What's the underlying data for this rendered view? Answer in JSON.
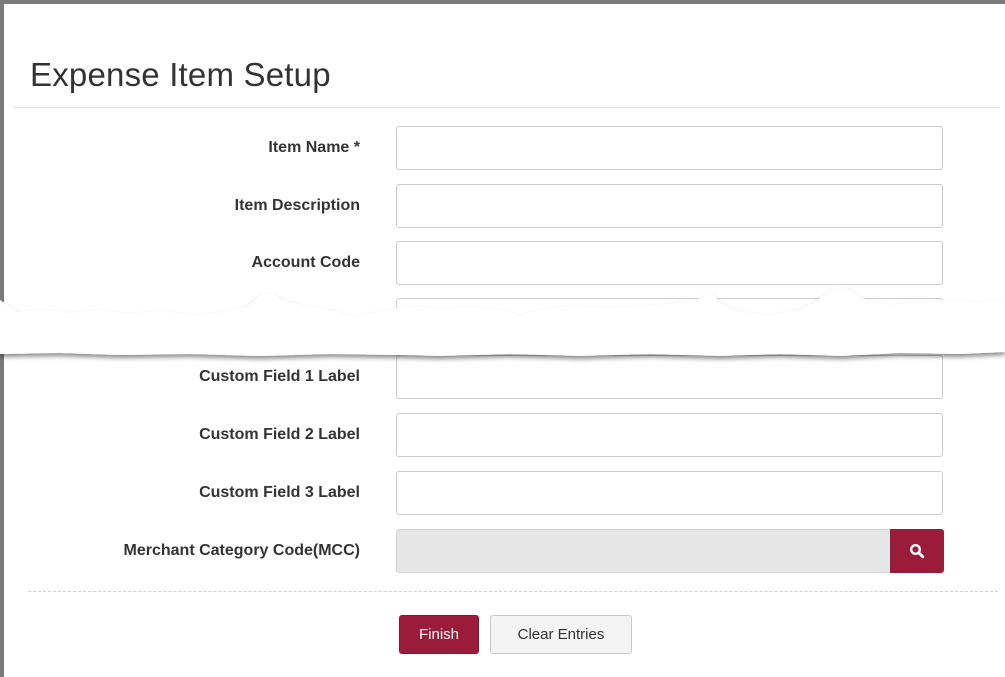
{
  "page": {
    "title": "Expense Item Setup"
  },
  "form": {
    "fields": [
      {
        "label": "Item Name *",
        "value": "",
        "placeholder": ""
      },
      {
        "label": "Item Description",
        "value": "",
        "placeholder": ""
      },
      {
        "label": "Account Code",
        "value": "",
        "placeholder": ""
      },
      {
        "label": "Custom Field 1 Label",
        "value": "",
        "placeholder": ""
      },
      {
        "label": "Custom Field 2 Label",
        "value": "",
        "placeholder": ""
      },
      {
        "label": "Custom Field 3 Label",
        "value": "",
        "placeholder": ""
      }
    ],
    "mcc": {
      "label": "Merchant Category Code(MCC)",
      "value": "",
      "search_icon": "search-icon"
    }
  },
  "actions": {
    "finish_label": "Finish",
    "clear_label": "Clear Entries"
  },
  "colors": {
    "primary": "#9b1b3b",
    "disabled_field_bg": "#e6e6e6",
    "secondary_button_bg": "#f3f3f3"
  }
}
